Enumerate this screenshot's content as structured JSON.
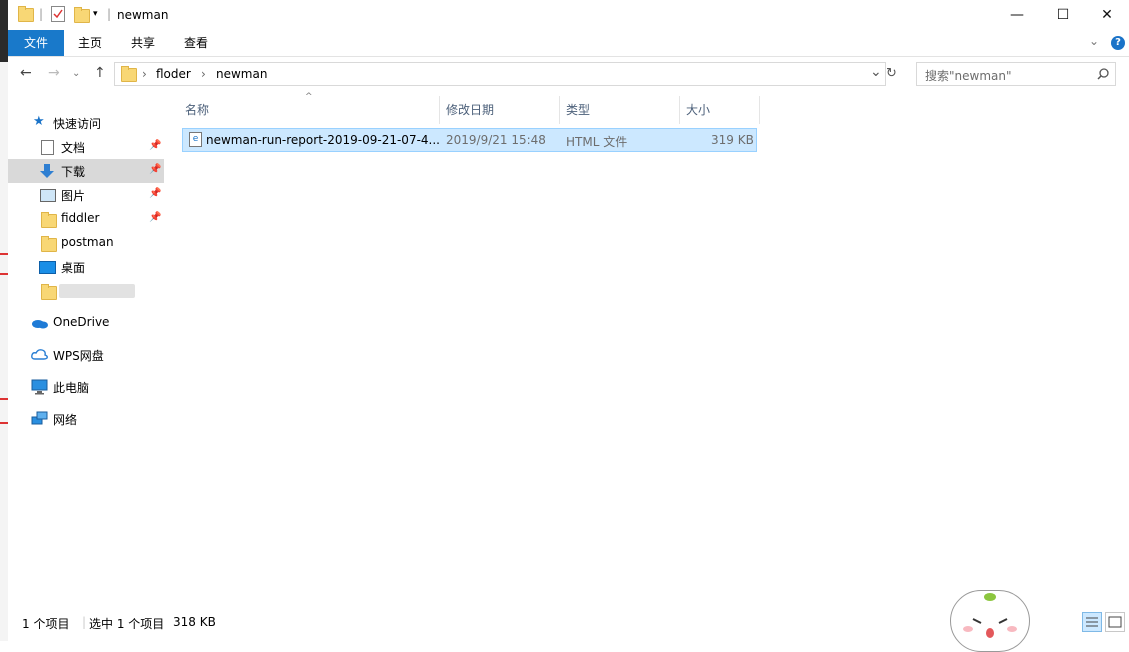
{
  "window": {
    "title": "newman",
    "controls": {
      "minimize": "—",
      "maximize": "☐",
      "close": "✕"
    }
  },
  "ribbon": {
    "tabs": [
      "文件",
      "主页",
      "共享",
      "查看"
    ],
    "help": "?"
  },
  "address": {
    "back": "←",
    "forward": "→",
    "up": "↑",
    "path": [
      "floder",
      "newman"
    ],
    "separator": "›",
    "dropdown": "⌄",
    "refresh": "↻"
  },
  "search": {
    "placeholder": "搜索\"newman\""
  },
  "sidebar": {
    "quick_access": "快速访问",
    "pinned": [
      {
        "label": "文档",
        "icon": "document-icon",
        "pinned": true
      },
      {
        "label": "下载",
        "icon": "download-icon",
        "pinned": true
      },
      {
        "label": "图片",
        "icon": "picture-icon",
        "pinned": true
      },
      {
        "label": "fiddler",
        "icon": "folder-icon",
        "pinned": true
      },
      {
        "label": "postman",
        "icon": "folder-icon",
        "pinned": false
      },
      {
        "label": "桌面",
        "icon": "desktop-icon",
        "pinned": false
      }
    ],
    "roots": [
      {
        "label": "OneDrive",
        "icon": "onedrive-icon"
      },
      {
        "label": "WPS网盘",
        "icon": "wps-cloud-icon"
      },
      {
        "label": "此电脑",
        "icon": "computer-icon"
      },
      {
        "label": "网络",
        "icon": "network-icon"
      }
    ]
  },
  "columns": [
    "名称",
    "修改日期",
    "类型",
    "大小"
  ],
  "files": [
    {
      "name": "newman-run-report-2019-09-21-07-4...",
      "modified": "2019/9/21 15:48",
      "type": "HTML 文件",
      "size": "319 KB"
    }
  ],
  "status": {
    "count": "1 个项目",
    "selected": "选中 1 个项目",
    "selected_size": "318 KB"
  },
  "colors": {
    "accent": "#1979ca",
    "selection": "#cce8ff",
    "header_text": "#4c607a"
  }
}
